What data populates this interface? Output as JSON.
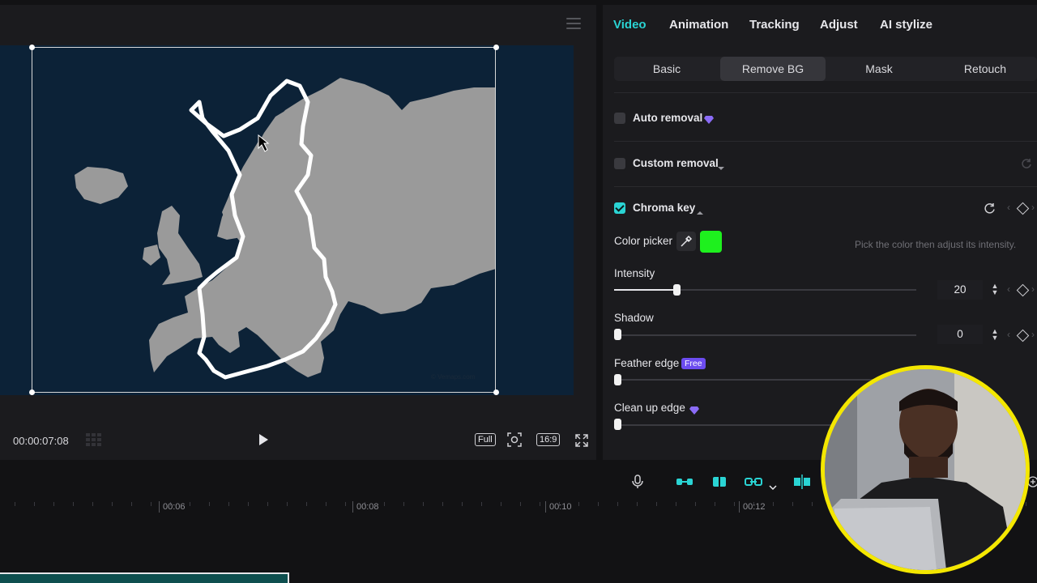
{
  "preview": {
    "timecode": "00:00:07:08",
    "buttons": {
      "full": "Full",
      "ratio": "16:9"
    },
    "watermark": "© Vemaps.com"
  },
  "props": {
    "tabs": [
      {
        "label": "Video",
        "active": true
      },
      {
        "label": "Animation"
      },
      {
        "label": "Tracking"
      },
      {
        "label": "Adjust"
      },
      {
        "label": "AI stylize"
      }
    ],
    "subtabs": [
      {
        "label": "Basic"
      },
      {
        "label": "Remove BG",
        "active": true
      },
      {
        "label": "Mask"
      },
      {
        "label": "Retouch"
      }
    ],
    "auto_removal": {
      "label": "Auto removal",
      "checked": false
    },
    "custom_removal": {
      "label": "Custom removal",
      "checked": false
    },
    "chroma_key": {
      "label": "Chroma key",
      "checked": true
    },
    "color_picker": {
      "label": "Color picker",
      "color": "#1ef01e",
      "hint": "Pick the color then adjust its intensity."
    },
    "intensity": {
      "label": "Intensity",
      "value": "20"
    },
    "shadow": {
      "label": "Shadow",
      "value": "0"
    },
    "feather_edge": {
      "label": "Feather edge",
      "badge": "Free"
    },
    "clean_up_edge": {
      "label": "Clean up edge"
    }
  },
  "timeline": {
    "ruler": [
      "00:06",
      "00:08",
      "00:10",
      "00:12"
    ]
  },
  "colors": {
    "accent": "#2ad4d4",
    "webcam_ring": "#f4e700",
    "premium": "#6c4cf0"
  }
}
